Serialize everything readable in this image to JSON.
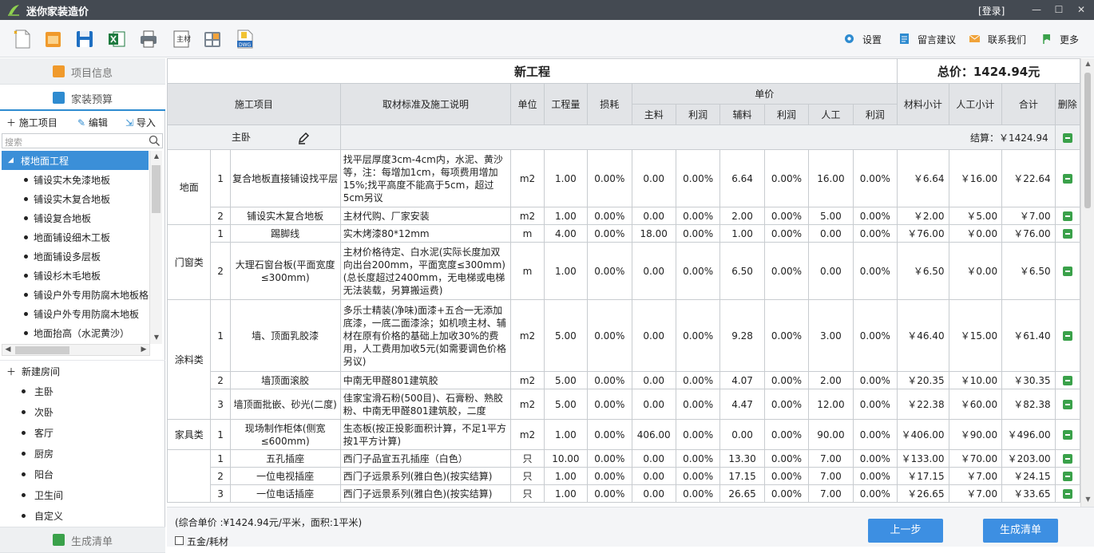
{
  "window": {
    "title": "迷你家装造价",
    "login": "[登录]",
    "minimize": "—",
    "maximize": "☐",
    "close": "✕"
  },
  "toolbar_right": [
    {
      "label": "设置",
      "icon": "gear-icon"
    },
    {
      "label": "留言建议",
      "icon": "message-icon"
    },
    {
      "label": "联系我们",
      "icon": "mail-icon"
    },
    {
      "label": "更多",
      "icon": "flag-icon"
    }
  ],
  "sidebar": {
    "tab_project_info": "项目信息",
    "tab_budget": "家装预算",
    "tab_generate": "生成清单",
    "action_add": "施工项目",
    "action_edit": "编辑",
    "action_import": "导入",
    "search_placeholder": "搜索",
    "tree_selected": "楼地面工程",
    "tree_items": [
      "铺设实木免漆地板",
      "铺设实木复合地板",
      "铺设复合地板",
      "地面铺设细木工板",
      "地面铺设多层板",
      "铺设杉木毛地板",
      "铺设户外专用防腐木地板格",
      "铺设户外专用防腐木地板",
      "地面抬高（水泥黄沙）"
    ],
    "new_room": "新建房间",
    "rooms": [
      "主卧",
      "次卧",
      "客厅",
      "厨房",
      "阳台",
      "卫生间",
      "自定义"
    ]
  },
  "table": {
    "project_name": "新工程",
    "total": "总价：1424.94元",
    "headers": {
      "item": "施工项目",
      "desc": "取材标准及施工说明",
      "unit": "单位",
      "qty": "工程量",
      "loss": "损耗",
      "unit_price": "单价",
      "main": "主料",
      "profit1": "利润",
      "aux": "辅料",
      "profit2": "利润",
      "labor": "人工",
      "profit3": "利润",
      "mat_sub": "材料小计",
      "labor_sub": "人工小计",
      "sum": "合计",
      "del": "删除"
    },
    "group_name": "主卧",
    "group_total": "结算：￥1424.94",
    "rows": [
      {
        "cat": "地面",
        "no": "1",
        "name": "复合地板直接铺设找平层",
        "desc": "找平层厚度3cm-4cm内，水泥、黄沙等，注：每增加1cm，每项费用增加15%;找平高度不能高于5cm，超过5cm另议",
        "unit": "m2",
        "qty": "1.00",
        "loss": "0.00%",
        "main": "0.00",
        "p1": "0.00%",
        "aux": "6.64",
        "p2": "0.00%",
        "labor": "16.00",
        "p3": "0.00%",
        "msub": "￥6.64",
        "lsub": "￥16.00",
        "sum": "￥22.64"
      },
      {
        "cat": "",
        "no": "2",
        "name": "铺设实木复合地板",
        "desc": "主材代购、厂家安装",
        "unit": "m2",
        "qty": "1.00",
        "loss": "0.00%",
        "main": "0.00",
        "p1": "0.00%",
        "aux": "2.00",
        "p2": "0.00%",
        "labor": "5.00",
        "p3": "0.00%",
        "msub": "￥2.00",
        "lsub": "￥5.00",
        "sum": "￥7.00"
      },
      {
        "cat": "门窗类",
        "no": "1",
        "name": "踢脚线",
        "desc": "实木烤漆80*12mm",
        "unit": "m",
        "qty": "4.00",
        "loss": "0.00%",
        "main": "18.00",
        "p1": "0.00%",
        "aux": "1.00",
        "p2": "0.00%",
        "labor": "0.00",
        "p3": "0.00%",
        "msub": "￥76.00",
        "lsub": "￥0.00",
        "sum": "￥76.00"
      },
      {
        "cat": "",
        "no": "2",
        "name": "大理石窗台板(平面宽度≤300mm)",
        "desc": "主材价格待定、白水泥(实际长度加双向出台200mm，平面宽度≤300mm)(总长度超过2400mm，无电梯或电梯无法装载，另算搬运费)",
        "unit": "m",
        "qty": "1.00",
        "loss": "0.00%",
        "main": "0.00",
        "p1": "0.00%",
        "aux": "6.50",
        "p2": "0.00%",
        "labor": "0.00",
        "p3": "0.00%",
        "msub": "￥6.50",
        "lsub": "￥0.00",
        "sum": "￥6.50"
      },
      {
        "cat": "涂料类",
        "no": "1",
        "name": "墙、顶面乳胶漆",
        "desc": "多乐士精装(净味)面漆+五合一无添加底漆，一底二面漆涂；如机喷主材、辅材在原有价格的基础上加收30%的费用，人工费用加收5元(如需要调色价格另议)",
        "unit": "m2",
        "qty": "5.00",
        "loss": "0.00%",
        "main": "0.00",
        "p1": "0.00%",
        "aux": "9.28",
        "p2": "0.00%",
        "labor": "3.00",
        "p3": "0.00%",
        "msub": "￥46.40",
        "lsub": "￥15.00",
        "sum": "￥61.40"
      },
      {
        "cat": "",
        "no": "2",
        "name": "墙顶面滚胶",
        "desc": "中南无甲醛801建筑胶",
        "unit": "m2",
        "qty": "5.00",
        "loss": "0.00%",
        "main": "0.00",
        "p1": "0.00%",
        "aux": "4.07",
        "p2": "0.00%",
        "labor": "2.00",
        "p3": "0.00%",
        "msub": "￥20.35",
        "lsub": "￥10.00",
        "sum": "￥30.35"
      },
      {
        "cat": "",
        "no": "3",
        "name": "墙顶面批嵌、砂光(二度)",
        "desc": "佳家宝滑石粉(500目)、石膏粉、熟胶粉、中南无甲醛801建筑胶，二度",
        "unit": "m2",
        "qty": "5.00",
        "loss": "0.00%",
        "main": "0.00",
        "p1": "0.00%",
        "aux": "4.47",
        "p2": "0.00%",
        "labor": "12.00",
        "p3": "0.00%",
        "msub": "￥22.38",
        "lsub": "￥60.00",
        "sum": "￥82.38"
      },
      {
        "cat": "家具类",
        "no": "1",
        "name": "现场制作柜体(侧宽≤600mm)",
        "desc": "生态板(按正投影面积计算，不足1平方按1平方计算)",
        "unit": "m2",
        "qty": "1.00",
        "loss": "0.00%",
        "main": "406.00",
        "p1": "0.00%",
        "aux": "0.00",
        "p2": "0.00%",
        "labor": "90.00",
        "p3": "0.00%",
        "msub": "￥406.00",
        "lsub": "￥90.00",
        "sum": "￥496.00"
      },
      {
        "cat": "",
        "no": "1",
        "name": "五孔插座",
        "desc": "西门子品宣五孔插座（白色）",
        "unit": "只",
        "qty": "10.00",
        "loss": "0.00%",
        "main": "0.00",
        "p1": "0.00%",
        "aux": "13.30",
        "p2": "0.00%",
        "labor": "7.00",
        "p3": "0.00%",
        "msub": "￥133.00",
        "lsub": "￥70.00",
        "sum": "￥203.00"
      },
      {
        "cat": "",
        "no": "2",
        "name": "一位电视插座",
        "desc": "西门子远景系列(雅白色)(按实结算)",
        "unit": "只",
        "qty": "1.00",
        "loss": "0.00%",
        "main": "0.00",
        "p1": "0.00%",
        "aux": "17.15",
        "p2": "0.00%",
        "labor": "7.00",
        "p3": "0.00%",
        "msub": "￥17.15",
        "lsub": "￥7.00",
        "sum": "￥24.15"
      },
      {
        "cat": "",
        "no": "3",
        "name": "一位电话插座",
        "desc": "西门子远景系列(雅白色)(按实结算)",
        "unit": "只",
        "qty": "1.00",
        "loss": "0.00%",
        "main": "0.00",
        "p1": "0.00%",
        "aux": "26.65",
        "p2": "0.00%",
        "labor": "7.00",
        "p3": "0.00%",
        "msub": "￥26.65",
        "lsub": "￥7.00",
        "sum": "￥33.65"
      }
    ]
  },
  "footer": {
    "summary": "(综合单价 :¥1424.94元/平米，面积:1平米)",
    "checkbox_label": "五金/耗材",
    "prev_button": "上一步",
    "generate_button": "生成清单"
  }
}
